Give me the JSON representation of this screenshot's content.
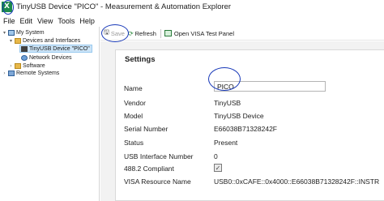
{
  "window": {
    "logo": "X",
    "title": "TinyUSB Device \"PICO\" - Measurement & Automation Explorer"
  },
  "menu": [
    "File",
    "Edit",
    "View",
    "Tools",
    "Help"
  ],
  "tree": {
    "my_system": "My System",
    "devices_interfaces": "Devices and Interfaces",
    "tinyusb_device": "TinyUSB Device \"PICO\"",
    "network_devices": "Network Devices",
    "software": "Software",
    "remote_systems": "Remote Systems"
  },
  "toolbar": {
    "save_label": "Save",
    "refresh_label": "Refresh",
    "visa_panel_label": "Open VISA Test Panel"
  },
  "settings": {
    "title": "Settings",
    "name_label": "Name",
    "name_value": "PICO",
    "vendor_label": "Vendor",
    "vendor_value": "TinyUSB",
    "model_label": "Model",
    "model_value": "TinyUSB Device",
    "serial_label": "Serial Number",
    "serial_value": "E66038B71328242F",
    "status_label": "Status",
    "status_value": "Present",
    "usb_if_label": "USB Interface Number",
    "usb_if_value": "0",
    "compliant_label": "488.2 Compliant",
    "compliant_checked": true,
    "visa_label": "VISA Resource Name",
    "visa_value": "USB0::0xCAFE::0x4000::E66038B71328242F::INSTR"
  },
  "colors": {
    "accent_logo": "#1c8a4c",
    "selection": "#cce4f7",
    "annotation": "#1738b8"
  },
  "icons": {
    "save": "floppy-disk-icon",
    "refresh": "refresh-icon",
    "visa": "visa-panel-icon"
  }
}
